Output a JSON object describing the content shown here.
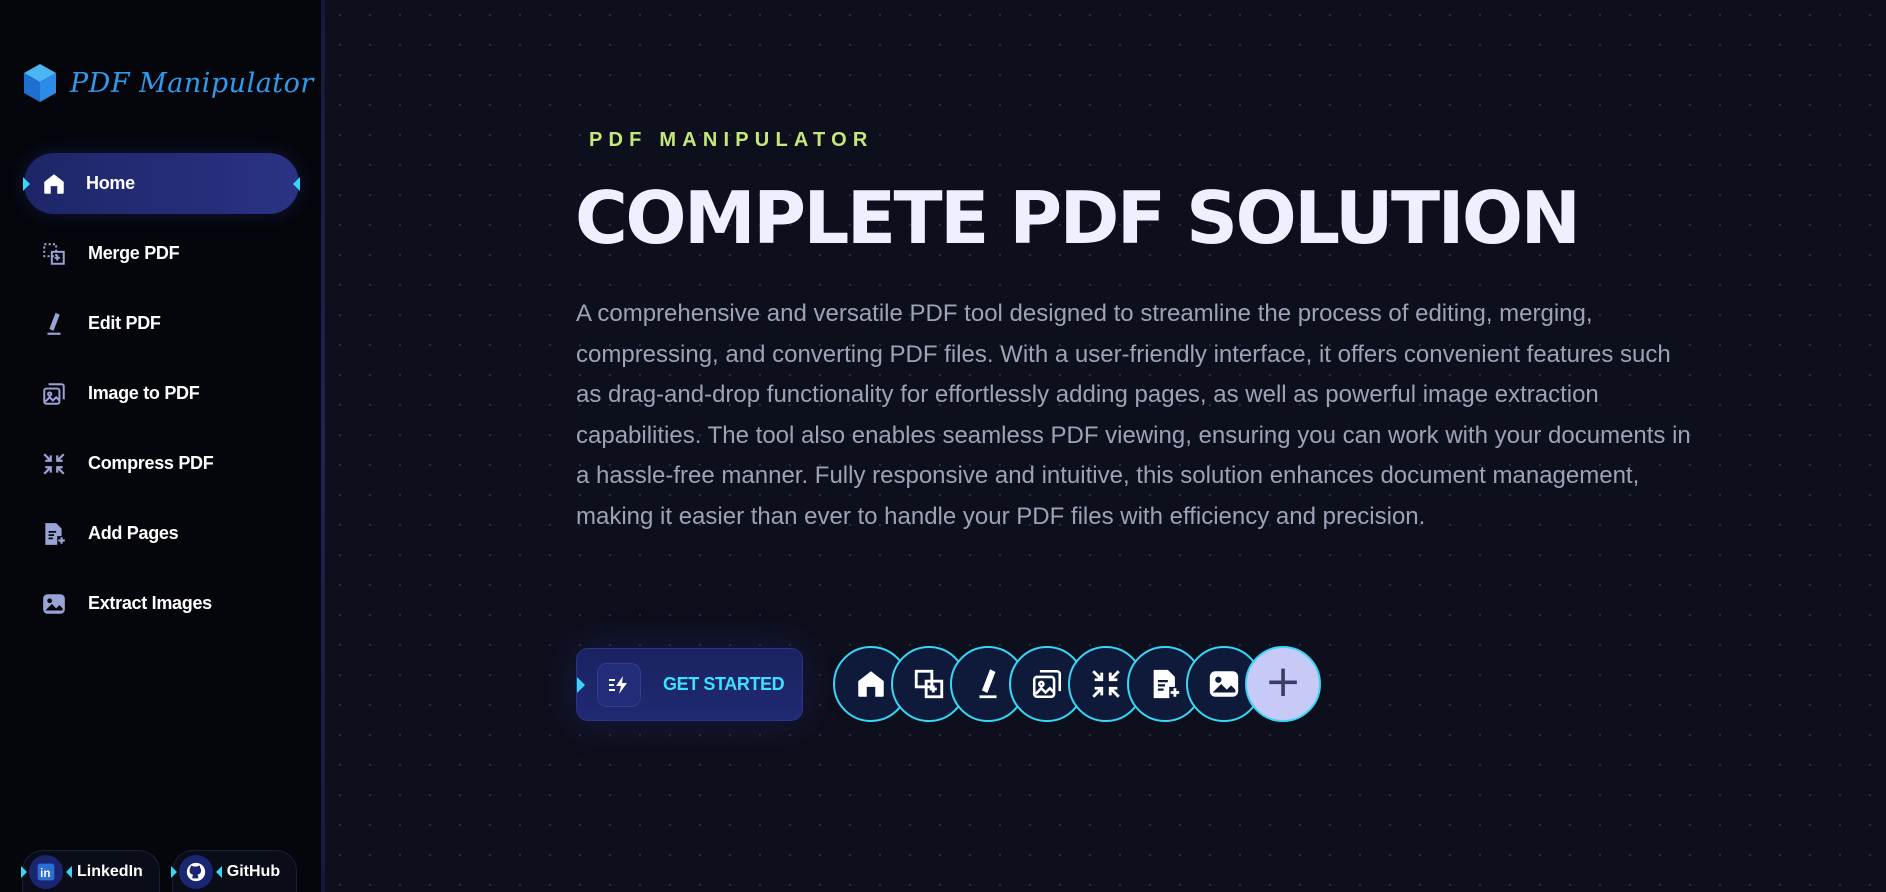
{
  "app": {
    "name": "PDF Manipulator"
  },
  "sidebar": {
    "items": [
      {
        "label": "Home",
        "icon": "home-icon",
        "active": true
      },
      {
        "label": "Merge PDF",
        "icon": "merge-icon",
        "active": false
      },
      {
        "label": "Edit PDF",
        "icon": "edit-icon",
        "active": false
      },
      {
        "label": "Image to PDF",
        "icon": "image-to-pdf-icon",
        "active": false
      },
      {
        "label": "Compress PDF",
        "icon": "compress-icon",
        "active": false
      },
      {
        "label": "Add Pages",
        "icon": "add-pages-icon",
        "active": false
      },
      {
        "label": "Extract Images",
        "icon": "extract-images-icon",
        "active": false
      }
    ],
    "social": [
      {
        "label": "LinkedIn",
        "icon": "linkedin-icon"
      },
      {
        "label": "GitHub",
        "icon": "github-icon"
      }
    ]
  },
  "hero": {
    "eyebrow": "PDF MANIPULATOR",
    "headline": "COMPLETE PDF SOLUTION",
    "description": "A comprehensive and versatile PDF tool designed to streamline the process of editing, merging, compressing, and converting PDF files. With a user-friendly interface, it offers convenient features such as drag-and-drop functionality for effortlessly adding pages, as well as powerful image extraction capabilities. The tool also enables seamless PDF viewing, ensuring you can work with your documents in a hassle-free manner. Fully responsive and intuitive, this solution enhances document management, making it easier than ever to handle your PDF files with efficiency and precision.",
    "cta_label": "GET STARTED",
    "cta_icon": "lightning-list-icon",
    "quick_icons": [
      "home-icon",
      "merge-icon",
      "edit-icon",
      "image-to-pdf-icon",
      "compress-icon",
      "add-pages-icon",
      "extract-images-icon",
      "plus-icon"
    ]
  },
  "colors": {
    "accent": "#37d7f5",
    "active_bg": "#1e2668",
    "eyebrow": "#c6e87a",
    "logo_text": "#2f9bea",
    "background": "#0e0f1c"
  }
}
